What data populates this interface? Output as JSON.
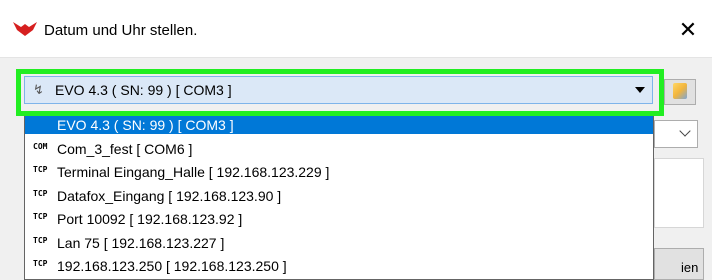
{
  "window": {
    "title": "Datum und Uhr stellen.",
    "close_glyph": "✕",
    "icon": "red-heart-logo-icon"
  },
  "device_combo": {
    "selected": "EVO 4.3 ( SN: 99 ) [ COM3 ]",
    "icon": "usb-icon"
  },
  "dropdown": {
    "items": [
      {
        "badge": "",
        "label": "EVO 4.3 ( SN: 99 ) [ COM3 ]",
        "selected": true
      },
      {
        "badge": "COM",
        "label": "Com_3_fest [ COM6 ]"
      },
      {
        "badge": "TCP",
        "label": "Terminal Eingang_Halle [ 192.168.123.229 ]"
      },
      {
        "badge": "TCP",
        "label": "Datafox_Eingang [ 192.168.123.90 ]"
      },
      {
        "badge": "TCP",
        "label": "Port 10092 [ 192.168.123.92 ]"
      },
      {
        "badge": "TCP",
        "label": "Lan 75 [ 192.168.123.227 ]"
      },
      {
        "badge": "TCP",
        "label": "192.168.123.250 [ 192.168.123.250 ]"
      }
    ]
  },
  "right_button": {
    "label": "ien"
  },
  "colors": {
    "highlight": "#22ee22",
    "selection": "#0078d7",
    "combo_bg": "#dbe8f7"
  }
}
